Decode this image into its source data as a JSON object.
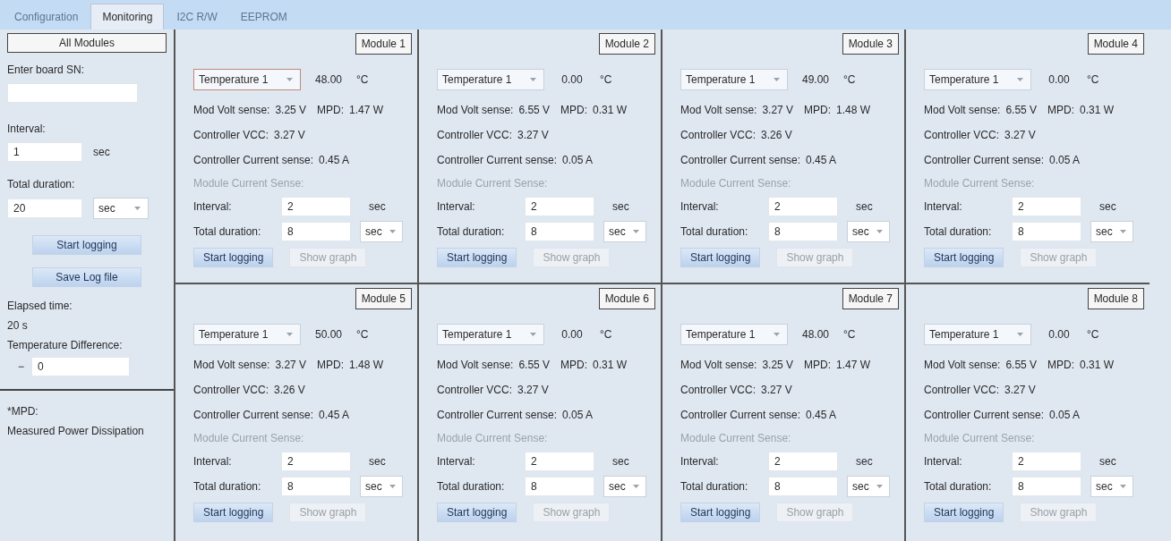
{
  "tabs": [
    {
      "label": "Configuration",
      "selected": false,
      "disabled": true
    },
    {
      "label": "Monitoring",
      "selected": true,
      "disabled": false
    },
    {
      "label": "I2C R/W",
      "selected": false,
      "disabled": true
    },
    {
      "label": "EEPROM",
      "selected": false,
      "disabled": true
    }
  ],
  "sidebar": {
    "header": "All Modules",
    "sn_label": "Enter board SN:",
    "interval_label": "Interval:",
    "interval": "1",
    "interval_unit": "sec",
    "duration_label": "Total duration:",
    "duration": "20",
    "duration_unit": "sec",
    "start_button": "Start logging",
    "save_button": "Save Log file",
    "elapsed_label": "Elapsed time:",
    "elapsed": "20 s",
    "diff_label": "Temperature Difference:",
    "diff_sign": "−",
    "diff": "0",
    "footnote_title": "*MPD:",
    "footnote": "Measured Power Dissipation"
  },
  "modules": [
    {
      "title": "Module 1",
      "sensor": "Temperature 1",
      "focused": true,
      "temperature": "48.00",
      "temp_unit": "°C",
      "volt_label": "Mod Volt sense:",
      "volt": "3.25 V",
      "mpd_label": "MPD:",
      "mpd": "1.47 W",
      "vcc_label": "Controller VCC:",
      "vcc": "3.27 V",
      "current_label": "Controller Current sense:",
      "current": "0.45 A",
      "mcs_label": "Module Current Sense:",
      "interval_label": "Interval:",
      "interval": "2",
      "interval_unit": "sec",
      "duration_label": "Total duration:",
      "duration": "8",
      "duration_unit": "sec",
      "start_button": "Start logging",
      "graph_button": "Show graph",
      "graph_disabled": true
    },
    {
      "title": "Module 2",
      "sensor": "Temperature 1",
      "focused": false,
      "temperature": "0.00",
      "temp_unit": "°C",
      "volt_label": "Mod Volt sense:",
      "volt": "6.55 V",
      "mpd_label": "MPD:",
      "mpd": "0.31 W",
      "vcc_label": "Controller VCC:",
      "vcc": "3.27 V",
      "current_label": "Controller Current sense:",
      "current": "0.05 A",
      "mcs_label": "Module Current Sense:",
      "interval_label": "Interval:",
      "interval": "2",
      "interval_unit": "sec",
      "duration_label": "Total duration:",
      "duration": "8",
      "duration_unit": "sec",
      "start_button": "Start logging",
      "graph_button": "Show graph",
      "graph_disabled": true
    },
    {
      "title": "Module 3",
      "sensor": "Temperature 1",
      "focused": false,
      "temperature": "49.00",
      "temp_unit": "°C",
      "volt_label": "Mod Volt sense:",
      "volt": "3.27 V",
      "mpd_label": "MPD:",
      "mpd": "1.48 W",
      "vcc_label": "Controller VCC:",
      "vcc": "3.26 V",
      "current_label": "Controller Current sense:",
      "current": "0.45 A",
      "mcs_label": "Module Current Sense:",
      "interval_label": "Interval:",
      "interval": "2",
      "interval_unit": "sec",
      "duration_label": "Total duration:",
      "duration": "8",
      "duration_unit": "sec",
      "start_button": "Start logging",
      "graph_button": "Show graph",
      "graph_disabled": true
    },
    {
      "title": "Module 4",
      "sensor": "Temperature 1",
      "focused": false,
      "temperature": "0.00",
      "temp_unit": "°C",
      "volt_label": "Mod Volt sense:",
      "volt": "6.55 V",
      "mpd_label": "MPD:",
      "mpd": "0.31 W",
      "vcc_label": "Controller VCC:",
      "vcc": "3.27 V",
      "current_label": "Controller Current sense:",
      "current": "0.05 A",
      "mcs_label": "Module Current Sense:",
      "interval_label": "Interval:",
      "interval": "2",
      "interval_unit": "sec",
      "duration_label": "Total duration:",
      "duration": "8",
      "duration_unit": "sec",
      "start_button": "Start logging",
      "graph_button": "Show graph",
      "graph_disabled": true
    },
    {
      "title": "Module 5",
      "sensor": "Temperature 1",
      "focused": false,
      "temperature": "50.00",
      "temp_unit": "°C",
      "volt_label": "Mod Volt sense:",
      "volt": "3.27 V",
      "mpd_label": "MPD:",
      "mpd": "1.48 W",
      "vcc_label": "Controller VCC:",
      "vcc": "3.26 V",
      "current_label": "Controller Current sense:",
      "current": "0.45 A",
      "mcs_label": "Module Current Sense:",
      "interval_label": "Interval:",
      "interval": "2",
      "interval_unit": "sec",
      "duration_label": "Total duration:",
      "duration": "8",
      "duration_unit": "sec",
      "start_button": "Start logging",
      "graph_button": "Show graph",
      "graph_disabled": true
    },
    {
      "title": "Module 6",
      "sensor": "Temperature 1",
      "focused": false,
      "temperature": "0.00",
      "temp_unit": "°C",
      "volt_label": "Mod Volt sense:",
      "volt": "6.55 V",
      "mpd_label": "MPD:",
      "mpd": "0.31 W",
      "vcc_label": "Controller VCC:",
      "vcc": "3.27 V",
      "current_label": "Controller Current sense:",
      "current": "0.05 A",
      "mcs_label": "Module Current Sense:",
      "interval_label": "Interval:",
      "interval": "2",
      "interval_unit": "sec",
      "duration_label": "Total duration:",
      "duration": "8",
      "duration_unit": "sec",
      "start_button": "Start logging",
      "graph_button": "Show graph",
      "graph_disabled": true
    },
    {
      "title": "Module 7",
      "sensor": "Temperature 1",
      "focused": false,
      "temperature": "48.00",
      "temp_unit": "°C",
      "volt_label": "Mod Volt sense:",
      "volt": "3.25 V",
      "mpd_label": "MPD:",
      "mpd": "1.47 W",
      "vcc_label": "Controller VCC:",
      "vcc": "3.27 V",
      "current_label": "Controller Current sense:",
      "current": "0.45 A",
      "mcs_label": "Module Current Sense:",
      "interval_label": "Interval:",
      "interval": "2",
      "interval_unit": "sec",
      "duration_label": "Total duration:",
      "duration": "8",
      "duration_unit": "sec",
      "start_button": "Start logging",
      "graph_button": "Show graph",
      "graph_disabled": true
    },
    {
      "title": "Module 8",
      "sensor": "Temperature 1",
      "focused": false,
      "temperature": "0.00",
      "temp_unit": "°C",
      "volt_label": "Mod Volt sense:",
      "volt": "6.55 V",
      "mpd_label": "MPD:",
      "mpd": "0.31 W",
      "vcc_label": "Controller VCC:",
      "vcc": "3.27 V",
      "current_label": "Controller Current sense:",
      "current": "0.05 A",
      "mcs_label": "Module Current Sense:",
      "interval_label": "Interval:",
      "interval": "2",
      "interval_unit": "sec",
      "duration_label": "Total duration:",
      "duration": "8",
      "duration_unit": "sec",
      "start_button": "Start logging",
      "graph_button": "Show graph",
      "graph_disabled": true
    }
  ]
}
